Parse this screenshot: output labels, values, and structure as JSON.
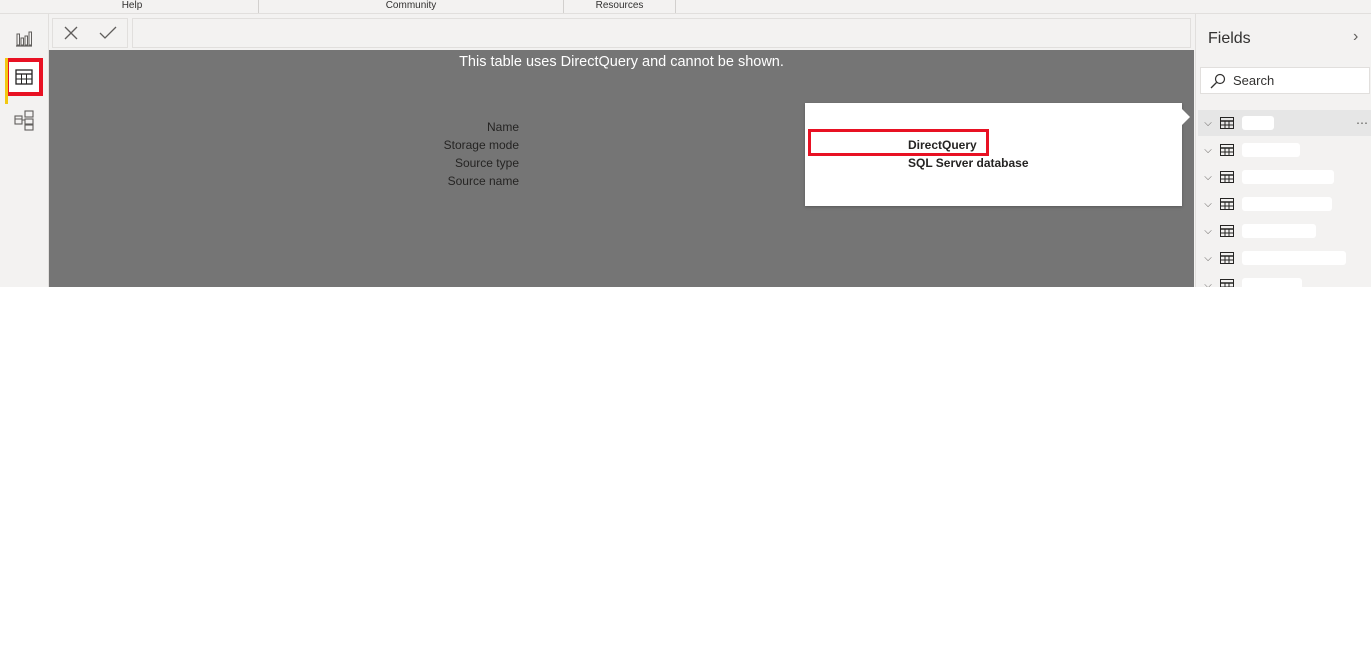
{
  "ribbon": {
    "groups": [
      {
        "label": "Help"
      },
      {
        "label": "Community"
      },
      {
        "label": "Resources"
      }
    ]
  },
  "rail": {
    "items": [
      {
        "name": "report-view",
        "icon": "bar-chart-icon",
        "active": false
      },
      {
        "name": "data-view",
        "icon": "table-icon",
        "active": true
      },
      {
        "name": "model-view",
        "icon": "model-icon",
        "active": false
      }
    ]
  },
  "formula_bar": {
    "cancel_icon": "x-icon",
    "commit_icon": "check-icon",
    "value": ""
  },
  "canvas": {
    "message": "This table uses DirectQuery and cannot be shown."
  },
  "tooltip": {
    "rows": [
      {
        "label": "Name",
        "value": ""
      },
      {
        "label": "Storage mode",
        "value": "DirectQuery"
      },
      {
        "label": "Source type",
        "value": "SQL Server database"
      },
      {
        "label": "Source name",
        "value": ""
      }
    ]
  },
  "fields": {
    "title": "Fields",
    "collapse_icon": "chevron-right-icon",
    "search_placeholder": "Search",
    "tables": [
      {
        "name": ""
      },
      {
        "name": ""
      },
      {
        "name": ""
      },
      {
        "name": ""
      },
      {
        "name": ""
      },
      {
        "name": ""
      },
      {
        "name": ""
      }
    ],
    "more_icon": "ellipsis-icon"
  },
  "colors": {
    "highlight": "#e81123",
    "canvas": "#757575",
    "accent": "#f2c811"
  }
}
